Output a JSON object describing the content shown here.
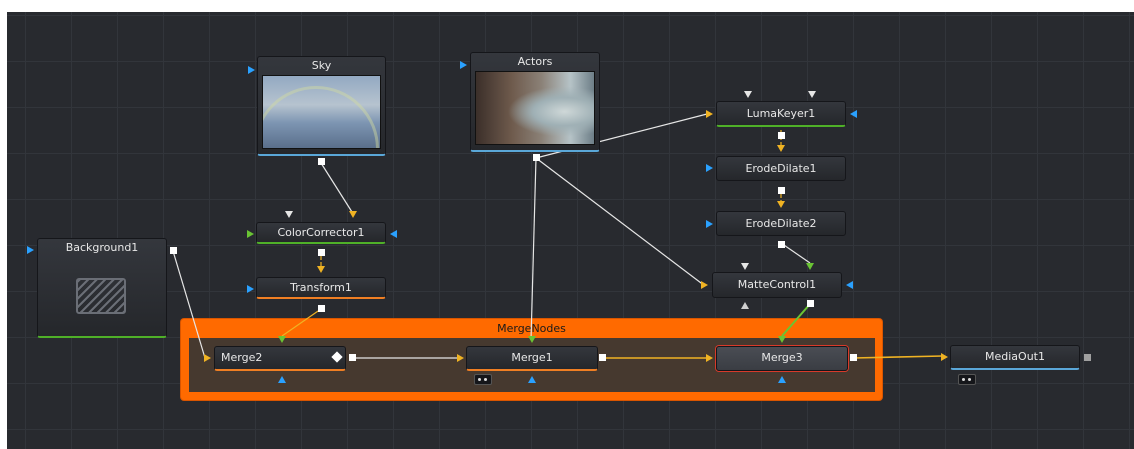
{
  "flow": {
    "group": {
      "label": "MergeNodes"
    },
    "nodes": {
      "sky": "Sky",
      "actors": "Actors",
      "background": "Background1",
      "color_corrector": "ColorCorrector1",
      "transform": "Transform1",
      "luma_keyer": "LumaKeyer1",
      "erode_dilate1": "ErodeDilate1",
      "erode_dilate2": "ErodeDilate2",
      "matte_control": "MatteControl1",
      "merge1": "Merge1",
      "merge2": "Merge2",
      "merge3": "Merge3",
      "media_out": "MediaOut1"
    }
  },
  "colors": {
    "group": "#ff6a00",
    "canvas": "#282a2f",
    "wire": "#e6e6e6",
    "foreground_wire": "#f0b323",
    "mask_wire": "#6ac434",
    "selected_outline": "#d83a2a"
  }
}
